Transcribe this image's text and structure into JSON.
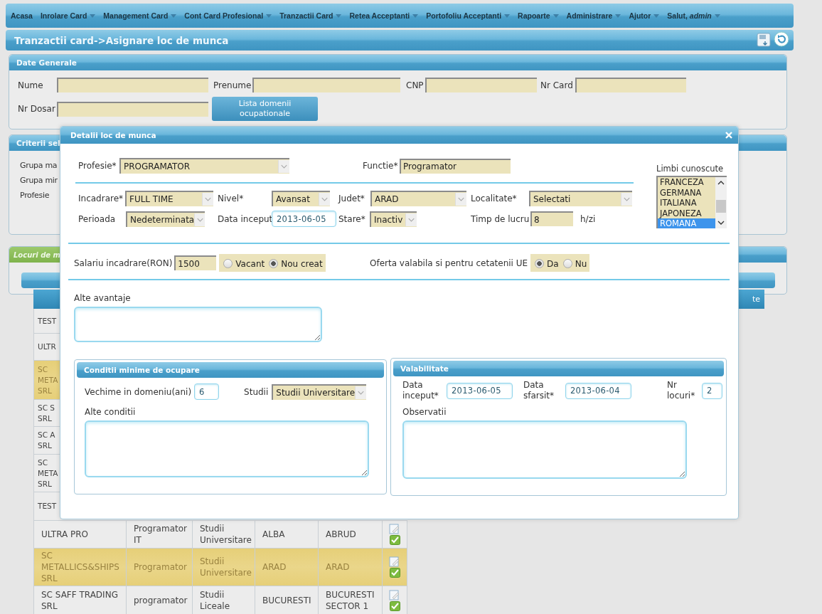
{
  "nav": [
    {
      "label": "Acasa",
      "dropdown": false
    },
    {
      "label": "Inrolare Card",
      "dropdown": true
    },
    {
      "label": "Management Card",
      "dropdown": true
    },
    {
      "label": "Cont Card Profesional",
      "dropdown": true
    },
    {
      "label": "Tranzactii Card",
      "dropdown": true
    },
    {
      "label": "Retea Acceptanti",
      "dropdown": true
    },
    {
      "label": "Portofoliu Acceptanti",
      "dropdown": true
    },
    {
      "label": "Rapoarte",
      "dropdown": true
    },
    {
      "label": "Administrare",
      "dropdown": true
    },
    {
      "label": "Ajutor",
      "dropdown": true
    },
    {
      "label": "Salut, *admin*",
      "dropdown": true
    }
  ],
  "page_title": "Tranzactii card->Asignare loc de munca",
  "date_generale": {
    "title": "Date Generale",
    "fields": [
      {
        "label": "Nume"
      },
      {
        "label": "Prenume"
      },
      {
        "label": "CNP"
      },
      {
        "label": "Nr Card"
      },
      {
        "label": "Nr Dosar"
      }
    ],
    "button": "Lista domenii ocupationale"
  },
  "criterii": {
    "title": "Criterii sel",
    "labels": [
      "Grupa ma",
      "Grupa mir",
      "Profesie"
    ]
  },
  "locuri": {
    "tab": "Locuri de m",
    "header_tail": "te",
    "covered_rows": [
      {
        "text": "TEST",
        "selected": false
      },
      {
        "text": "ULTR",
        "selected": false
      },
      {
        "text": "SC META SRL",
        "selected": true
      },
      {
        "text": "SC S SRL",
        "selected": false
      },
      {
        "text": "SC A SRL",
        "selected": false
      },
      {
        "text": "SC META SRL",
        "selected": false
      },
      {
        "text": "TEST",
        "selected": false
      }
    ],
    "rows": [
      {
        "cells": [
          "ULTRA PRO",
          "Programator IT",
          "Studii Universitare",
          "ALBA",
          "ABRUD"
        ],
        "selected": false
      },
      {
        "cells": [
          "SC METALLICS&SHIPS SRL",
          "Programator",
          "Studii Universitare",
          "ARAD",
          "ARAD"
        ],
        "selected": true
      },
      {
        "cells": [
          "SC SAFF TRADING SRL",
          "programator",
          "Studii Liceale",
          "BUCURESTI",
          "BUCURESTI SECTOR 1"
        ],
        "selected": false
      }
    ]
  },
  "modal": {
    "title": "Detalii loc de munca",
    "profesie": {
      "label": "Profesie*",
      "value": "PROGRAMATOR"
    },
    "functie": {
      "label": "Functie*",
      "value": "Programator"
    },
    "incadrare": {
      "label": "Incadrare*",
      "value": "FULL TIME"
    },
    "nivel": {
      "label": "Nivel*",
      "value": "Avansat"
    },
    "judet": {
      "label": "Judet*",
      "value": "ARAD"
    },
    "localitate": {
      "label": "Localitate*",
      "value": "Selectati"
    },
    "perioada": {
      "label": "Perioada",
      "value": "Nedeterminata"
    },
    "data_inceput": {
      "label": "Data inceput",
      "value": "2013-06-05"
    },
    "stare": {
      "label": "Stare*",
      "value": "Inactiv"
    },
    "timp": {
      "label": "Timp de lucru",
      "value": "8",
      "unit": "h/zi"
    },
    "limbi": {
      "label": "Limbi cunoscute",
      "items": [
        {
          "label": "FRANCEZA",
          "selected": false
        },
        {
          "label": "GERMANA",
          "selected": false
        },
        {
          "label": "ITALIANA",
          "selected": false
        },
        {
          "label": "JAPONEZA",
          "selected": false
        },
        {
          "label": "ROMANA",
          "selected": true
        }
      ]
    },
    "salariu": {
      "label": "Salariu incadrare(RON)",
      "value": "1500",
      "options": [
        {
          "label": "Vacant",
          "selected": false
        },
        {
          "label": "Nou creat",
          "selected": true
        }
      ]
    },
    "oferta": {
      "label": "Oferta valabila si pentru cetatenii UE",
      "options": [
        {
          "label": "Da",
          "selected": true
        },
        {
          "label": "Nu",
          "selected": false
        }
      ]
    },
    "alte_avantaje": {
      "label": "Alte avantaje"
    },
    "conditii": {
      "title": "Conditii minime de ocupare",
      "vechime": {
        "label": "Vechime in domeniu(ani)",
        "value": "6"
      },
      "studii": {
        "label": "Studii",
        "value": "Studii Universitare"
      },
      "alte": {
        "label": "Alte conditii"
      }
    },
    "valabilitate": {
      "title": "Valabilitate",
      "data_inceput": {
        "label": "Data inceput*",
        "value": "2013-06-05"
      },
      "data_sfarsit": {
        "label": "Data sfarsit*",
        "value": "2013-06-04"
      },
      "nr_locuri": {
        "label": "Nr locuri*",
        "value": "2"
      },
      "observatii": {
        "label": "Observatii"
      }
    }
  }
}
